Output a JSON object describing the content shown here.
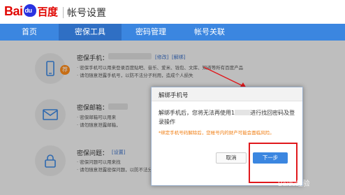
{
  "header": {
    "logo_text": "Bai",
    "logo_du": "du",
    "logo_cn": "百度",
    "title": "帐号设置"
  },
  "nav": {
    "items": [
      {
        "label": "首页",
        "active": false
      },
      {
        "label": "密保工具",
        "active": true
      },
      {
        "label": "密码管理",
        "active": false
      },
      {
        "label": "帐号关联",
        "active": false
      }
    ]
  },
  "sections": {
    "phone": {
      "badge": "荐",
      "label": "密保手机：",
      "links": [
        "[修改]",
        "[解绑]"
      ],
      "desc1": "密保手机可以用来登录百度贴吧、音乐、爱米、钱包、文库、知道等所有百度产品",
      "desc2": "请勿随意泄露手机号，以防不法分子利用，造成个人损失"
    },
    "email": {
      "label": "密保邮箱：",
      "desc1": "密保邮箱可以用来",
      "desc2": "请勿随意泄露邮箱，"
    },
    "question": {
      "label": "密保问题：",
      "link": "[设置]",
      "desc1": "密保问题可以用来找",
      "desc2": "请勿随意泄露密保问题，以防不法分子利用，造成个人损失"
    }
  },
  "dialog": {
    "title": "解绑手机号",
    "text_a": "解绑手机后，您将无法再使用1",
    "text_b": "进行找回密码及登录操作",
    "warning": "*绑定手机号码解除后，您帐号内的财产可能会面临风险。",
    "cancel_label": "取消",
    "next_label": "下一步"
  },
  "watermark": "Baidu经验",
  "colors": {
    "brand_red": "#e10602",
    "nav_blue": "#3b86e0",
    "warn_orange": "#f07d11",
    "highlight_red": "#e0181c"
  }
}
